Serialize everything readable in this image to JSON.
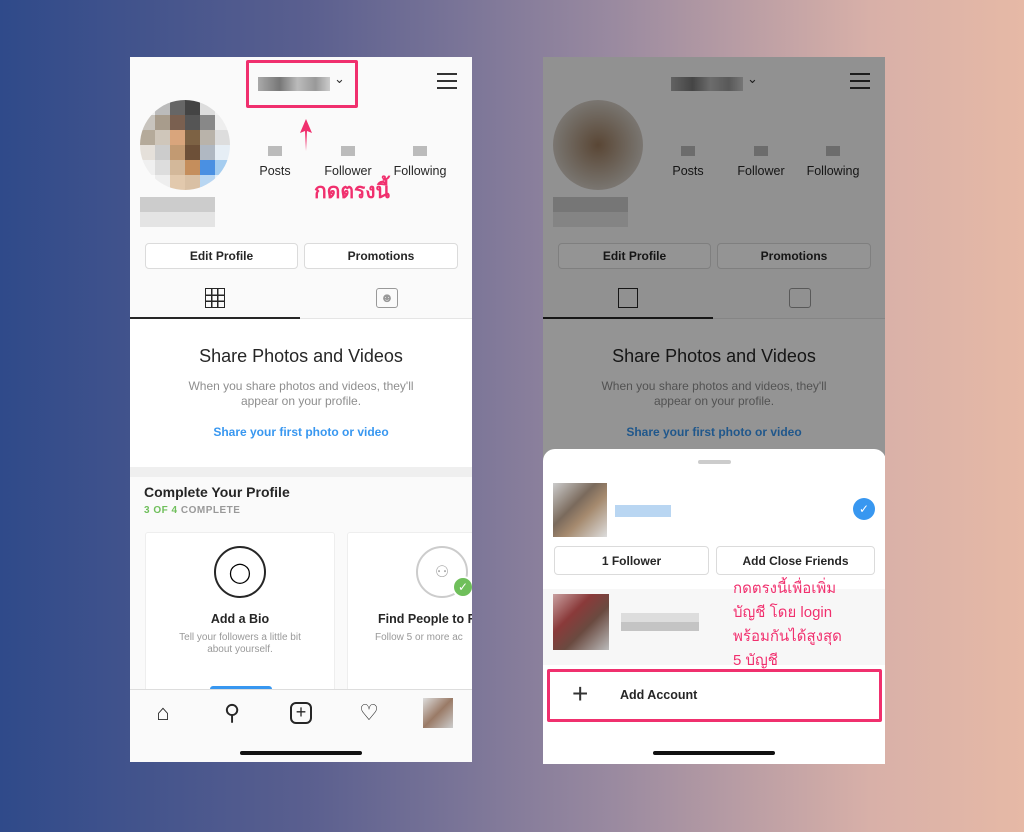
{
  "profile": {
    "stats": [
      {
        "label": "Posts"
      },
      {
        "label": "Follower"
      },
      {
        "label": "Following"
      }
    ],
    "edit_profile": "Edit Profile",
    "promotions": "Promotions",
    "empty_title": "Share Photos and Videos",
    "empty_desc": "When you share photos and videos, they'll appear on your profile.",
    "empty_link": "Share your first photo or video",
    "complete_title": "Complete Your Profile",
    "complete_done": "3 OF 4",
    "complete_word": "COMPLETE",
    "cards": [
      {
        "title": "Add a Bio",
        "desc": "Tell your followers a little bit",
        "desc2": "about yourself.",
        "icon": "speech-bubble-icon"
      },
      {
        "title": "Find People to F",
        "desc": "Follow 5 or more ac",
        "icon": "people-icon"
      }
    ]
  },
  "annotations": {
    "tap_here": "กดตรงนี้",
    "add_note": [
      "กดตรงนี้เพื่อเพิ่ม",
      "บัญชี โดย login",
      "พร้อมกันได้สูงสุด",
      "5 บัญชี"
    ],
    "highlight_color": "#f0306e"
  },
  "sheet": {
    "follower_btn": "1 Follower",
    "close_friends_btn": "Add Close Friends",
    "add_account": "Add Account"
  },
  "colors": {
    "link": "#3897f0",
    "complete": "#6fbf5b",
    "check": "#3897f0"
  }
}
